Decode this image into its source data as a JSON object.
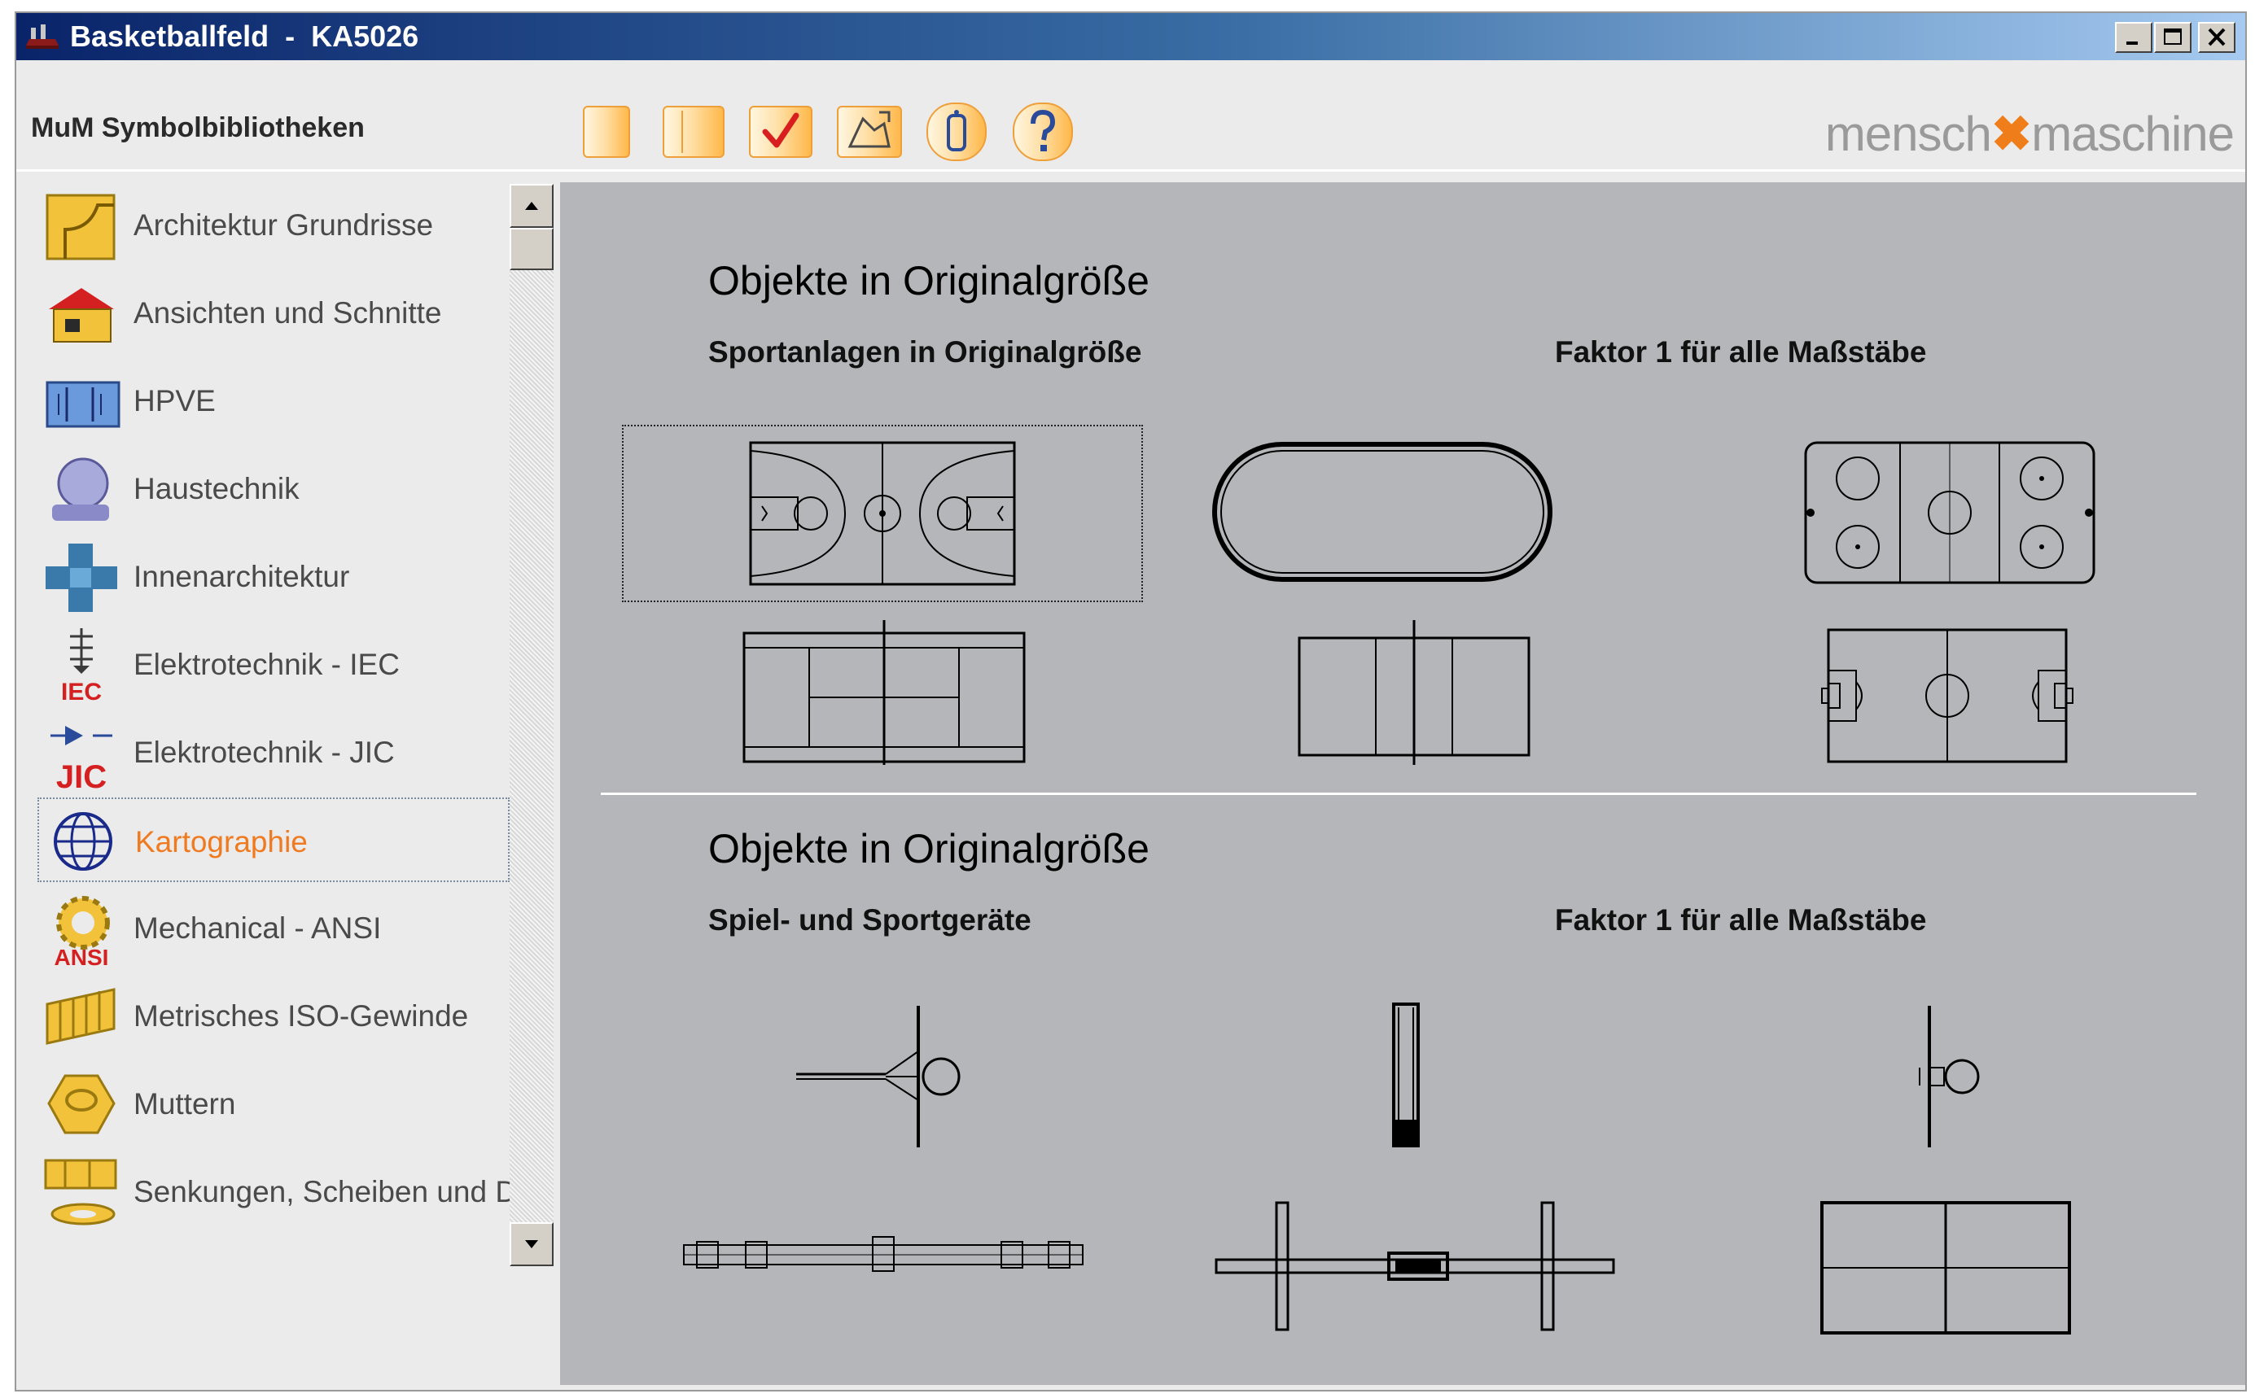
{
  "window": {
    "title": "Basketballfeld  -  KA5026",
    "buttons": [
      "minimize",
      "maximize",
      "close"
    ]
  },
  "header": {
    "app_title": "MuM Symbolbibliotheken",
    "toolbar": [
      {
        "name": "new-icon"
      },
      {
        "name": "book-icon"
      },
      {
        "name": "checkmark-icon"
      },
      {
        "name": "insert-icon"
      },
      {
        "name": "info-icon"
      },
      {
        "name": "help-icon"
      }
    ],
    "logo": {
      "left": "mensch",
      "mid": "✖",
      "right": "maschine"
    }
  },
  "sidebar": {
    "items": [
      {
        "label": "Architektur Grundrisse",
        "icon": "floorplan-icon"
      },
      {
        "label": "Ansichten und Schnitte",
        "icon": "house-icon"
      },
      {
        "label": "HPVE",
        "icon": "hpve-icon"
      },
      {
        "label": "Haustechnik",
        "icon": "pipe-icon"
      },
      {
        "label": "Innenarchitektur",
        "icon": "furniture-icon"
      },
      {
        "label": "Elektrotechnik - IEC",
        "icon": "iec-icon",
        "icon_text": "IEC"
      },
      {
        "label": "Elektrotechnik - JIC",
        "icon": "jic-icon",
        "icon_text": "JIC"
      },
      {
        "label": "Kartographie",
        "icon": "globe-icon",
        "selected": true
      },
      {
        "label": "Mechanical - ANSI",
        "icon": "gear-icon",
        "icon_text": "ANSI"
      },
      {
        "label": "Metrisches ISO-Gewinde",
        "icon": "thread-icon"
      },
      {
        "label": "Muttern",
        "icon": "nut-icon"
      },
      {
        "label": "Senkungen, Scheiben und Du",
        "icon": "washer-icon"
      }
    ]
  },
  "content": {
    "sections": [
      {
        "title": "Objekte in Originalgröße",
        "left_sub": "Sportanlagen in Originalgröße",
        "right_sub": "Faktor 1 für alle Maßstäbe"
      },
      {
        "title": "Objekte in Originalgröße",
        "left_sub": "Spiel- und Sportgeräte",
        "right_sub": "Faktor 1 für alle Maßstäbe"
      }
    ],
    "symbols": [
      "basketball-court",
      "running-track",
      "ice-hockey-rink",
      "tennis-court",
      "volleyball-court",
      "football-field",
      "basketball-hoop",
      "goal-post",
      "basketball-post",
      "beam",
      "seesaw",
      "table-tennis-table"
    ]
  },
  "colors": {
    "accent": "#f07a20",
    "titlebar": "#0a246a",
    "content_bg": "#b4b6b9"
  }
}
